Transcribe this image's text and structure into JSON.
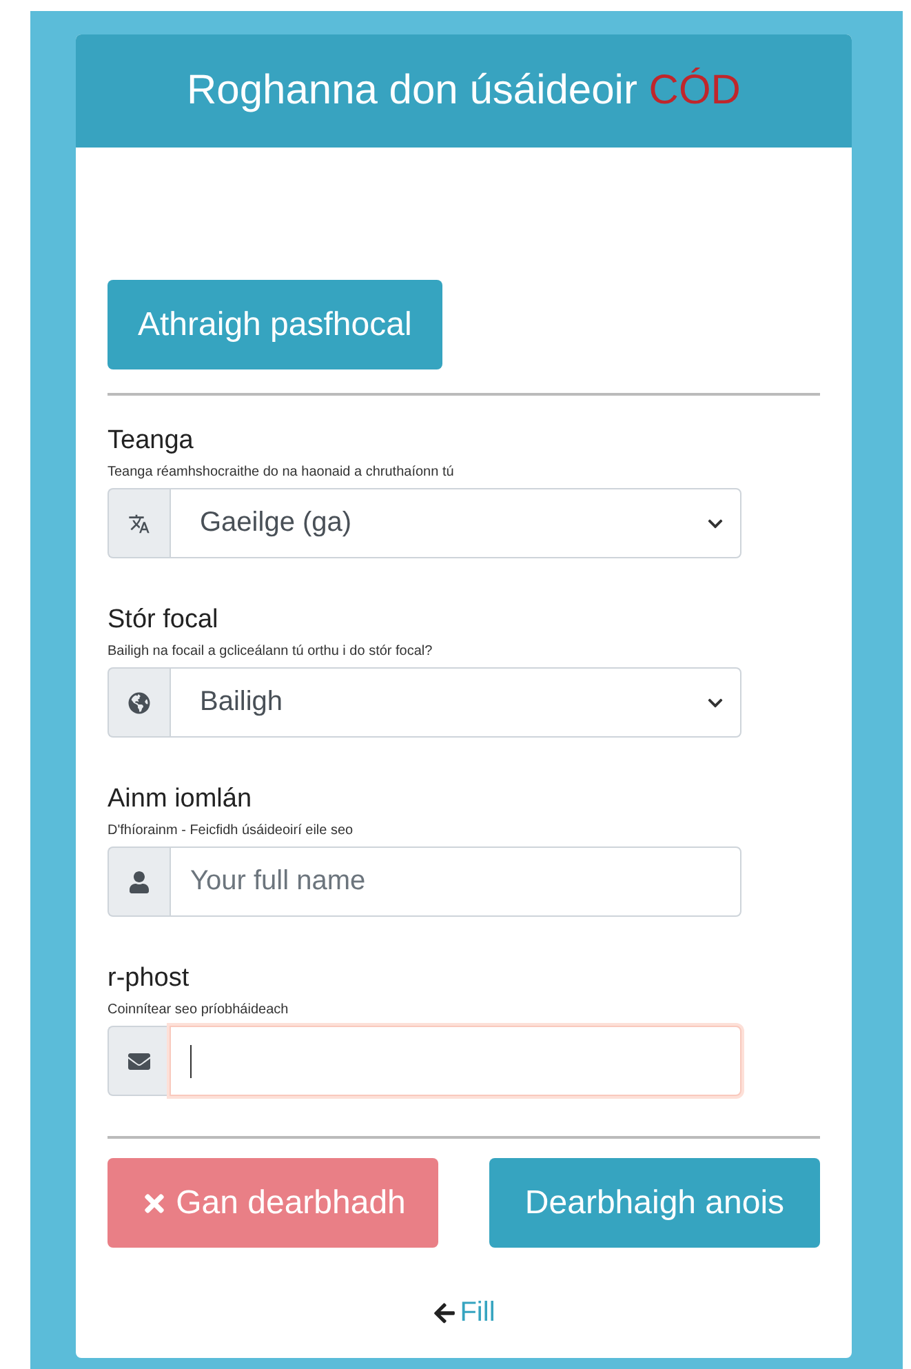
{
  "header": {
    "title": "Roghanna don úsáideoir",
    "highlight": "CÓD"
  },
  "change_password_button": "Athraigh pasfhocal",
  "fields": [
    {
      "kind": "select",
      "label": "Teanga",
      "hint": "Teanga réamhshocraithe do na haonaid a chruthaíonn tú",
      "value": "Gaeilge (ga)",
      "focused": false
    },
    {
      "kind": "select",
      "label": "Stór focal",
      "hint": "Bailigh na focail a gcliceálann tú orthu i do stór focal?",
      "value": "Bailigh",
      "focused": false
    },
    {
      "kind": "input",
      "label": "Ainm iomlán",
      "hint": "D'fhíorainm - Feicfidh úsáideoirí eile seo",
      "placeholder": "Your full name",
      "focused": false
    },
    {
      "kind": "input",
      "label": "r-phost",
      "hint": "Coinnítear seo príobháideach",
      "focused": true
    }
  ],
  "buttons": [
    {
      "kind": "danger",
      "label": "Gan dearbhadh"
    },
    {
      "kind": "primary",
      "label": "Dearbhaigh anois"
    }
  ],
  "back_link": "Fill"
}
